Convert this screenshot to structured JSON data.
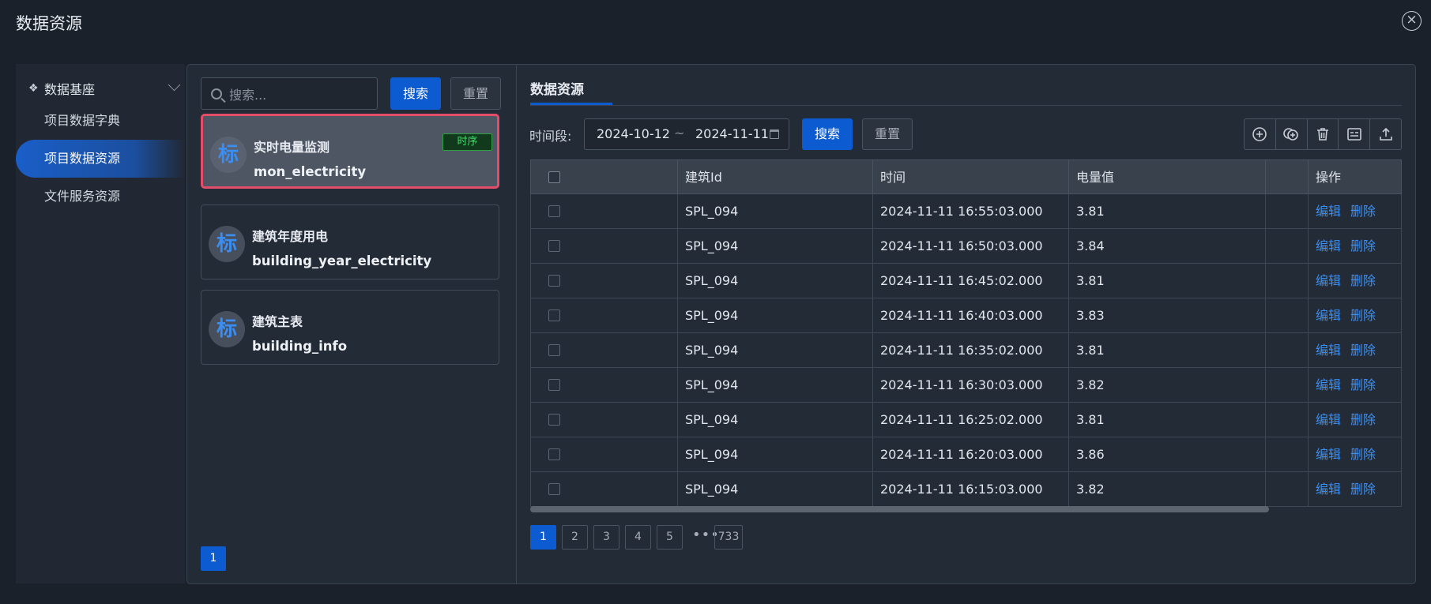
{
  "window": {
    "title": "数据资源",
    "close_icon": "close-icon"
  },
  "sidebar": {
    "group": {
      "icon": "dropbox-icon",
      "label": "数据基座",
      "expanded": true
    },
    "items": [
      {
        "label": "项目数据字典",
        "active": false
      },
      {
        "label": "项目数据资源",
        "active": true
      },
      {
        "label": "文件服务资源",
        "active": false
      }
    ]
  },
  "left_panel": {
    "search": {
      "placeholder": "搜索...",
      "value": ""
    },
    "search_button": "搜索",
    "reset_button": "重置",
    "cards": [
      {
        "avatar": "标",
        "name": "实时电量监测",
        "code": "mon_electricity",
        "tag": "时序",
        "selected": true
      },
      {
        "avatar": "标",
        "name": "建筑年度用电",
        "code": "building_year_electricity",
        "tag": "",
        "selected": false
      },
      {
        "avatar": "标",
        "name": "建筑主表",
        "code": "building_info",
        "tag": "",
        "selected": false
      }
    ],
    "page": "1"
  },
  "right_panel": {
    "tab": "数据资源",
    "filter": {
      "label": "时间段:",
      "start": "2024-10-12",
      "separator": "~",
      "end": "2024-11-11",
      "search_button": "搜索",
      "reset_button": "重置"
    },
    "toolbar_icons": [
      "add-circle-icon",
      "copy-add-icon",
      "trash-icon",
      "template-icon",
      "upload-icon"
    ],
    "table": {
      "columns": [
        "",
        "建筑Id",
        "时间",
        "电量值",
        "",
        "操作"
      ],
      "rows": [
        {
          "building_id": "SPL_094",
          "time": "2024-11-11 16:55:03.000",
          "value": "3.81"
        },
        {
          "building_id": "SPL_094",
          "time": "2024-11-11 16:50:03.000",
          "value": "3.84"
        },
        {
          "building_id": "SPL_094",
          "time": "2024-11-11 16:45:02.000",
          "value": "3.81"
        },
        {
          "building_id": "SPL_094",
          "time": "2024-11-11 16:40:03.000",
          "value": "3.83"
        },
        {
          "building_id": "SPL_094",
          "time": "2024-11-11 16:35:02.000",
          "value": "3.81"
        },
        {
          "building_id": "SPL_094",
          "time": "2024-11-11 16:30:03.000",
          "value": "3.82"
        },
        {
          "building_id": "SPL_094",
          "time": "2024-11-11 16:25:02.000",
          "value": "3.81"
        },
        {
          "building_id": "SPL_094",
          "time": "2024-11-11 16:20:03.000",
          "value": "3.86"
        },
        {
          "building_id": "SPL_094",
          "time": "2024-11-11 16:15:03.000",
          "value": "3.82"
        }
      ],
      "edit_label": "编辑",
      "delete_label": "删除"
    },
    "pagination": {
      "pages": [
        "1",
        "2",
        "3",
        "4",
        "5"
      ],
      "current": "1",
      "ellipsis": "•••",
      "last": "733"
    }
  },
  "colors": {
    "primary": "#0d5bd1",
    "link": "#3d8ff2",
    "selected_border": "#e34d6a",
    "tag_green": "#3ee06a"
  }
}
